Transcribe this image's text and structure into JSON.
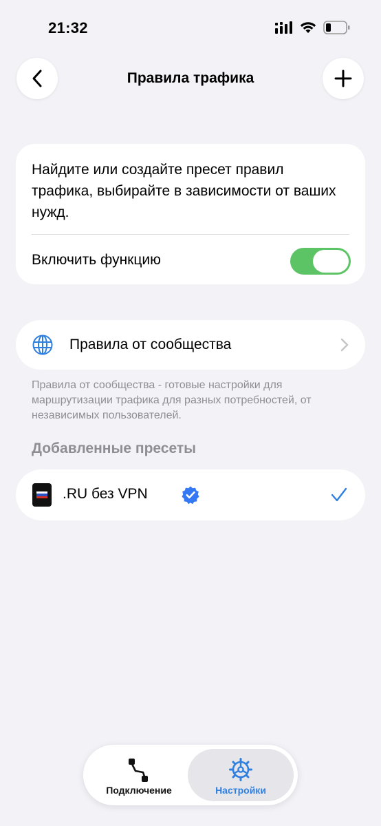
{
  "status_bar": {
    "time": "21:32"
  },
  "nav": {
    "title": "Правила трафика"
  },
  "intro": {
    "description": "Найдите или создайте пресет правил трафика, выбирайте в зависимости от ваших нужд.",
    "toggle_label": "Включить функцию",
    "toggle_on": true
  },
  "community": {
    "label": "Правила от сообщества",
    "footnote": "Правила от сообщества - готовые настройки для маршрутизации трафика для разных потребностей, от независимых пользователей."
  },
  "presets": {
    "header": "Добавленные пресеты",
    "items": [
      {
        "label": ".RU без VPN",
        "verified": true,
        "selected": true
      }
    ]
  },
  "tabs": [
    {
      "label": "Подключение",
      "icon": "connection-icon",
      "active": false
    },
    {
      "label": "Настройки",
      "icon": "settings-icon",
      "active": true
    }
  ],
  "colors": {
    "background": "#f2f2f7",
    "accent": "#2f7fe0",
    "toggle_on": "#5dc466",
    "secondary_text": "#8e8e93"
  }
}
